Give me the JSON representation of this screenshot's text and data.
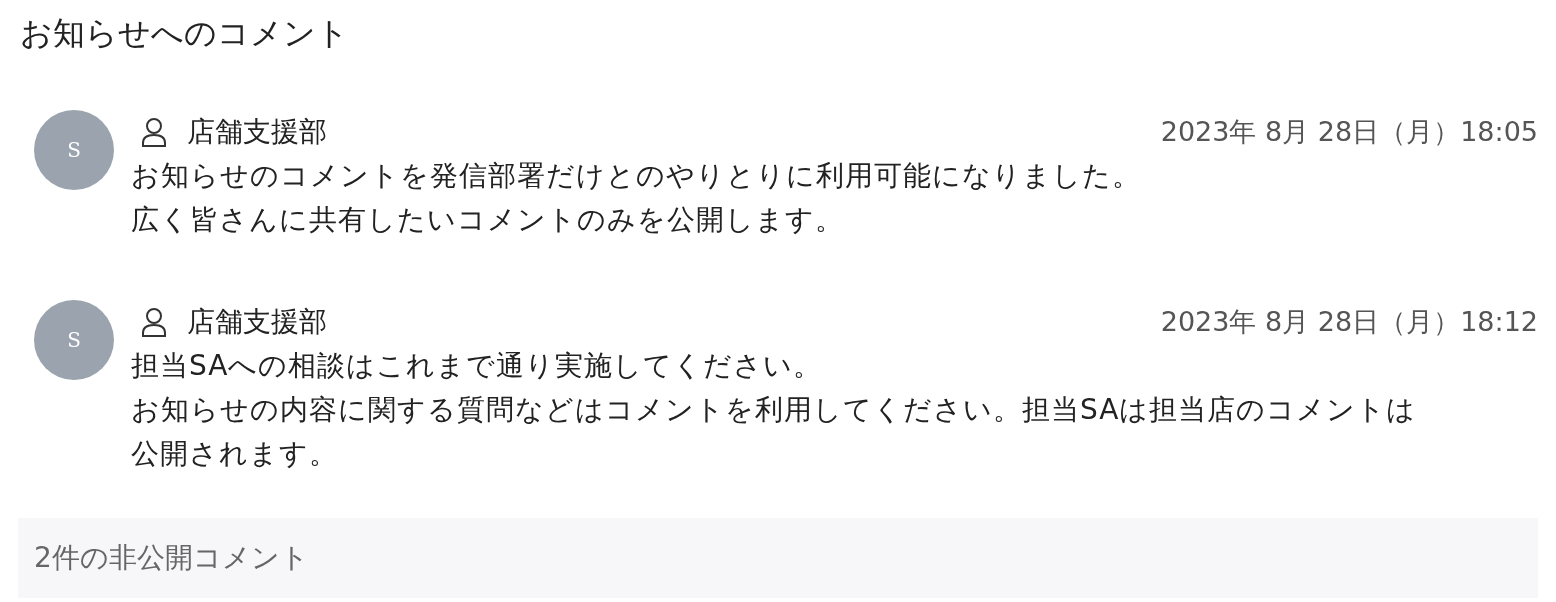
{
  "title": "お知らせへのコメント",
  "comments": [
    {
      "avatar": "S",
      "author": "店舗支援部",
      "date": "2023年 8月 28日（月）18:05",
      "paragraphs": [
        "お知らせのコメントを発信部署だけとのやりとりに利用可能になりました。",
        "広く皆さんに共有したいコメントのみを公開します。"
      ]
    },
    {
      "avatar": "S",
      "author": "店舗支援部",
      "date": "2023年 8月 28日（月）18:12",
      "paragraphs": [
        "担当SAへの相談はこれまで通り実施してください。",
        "お知らせの内容に関する質問などはコメントを利用してください。担当SAは担当店のコメントは公開されます。"
      ]
    }
  ],
  "hidden_comments": "2件の非公開コメント"
}
